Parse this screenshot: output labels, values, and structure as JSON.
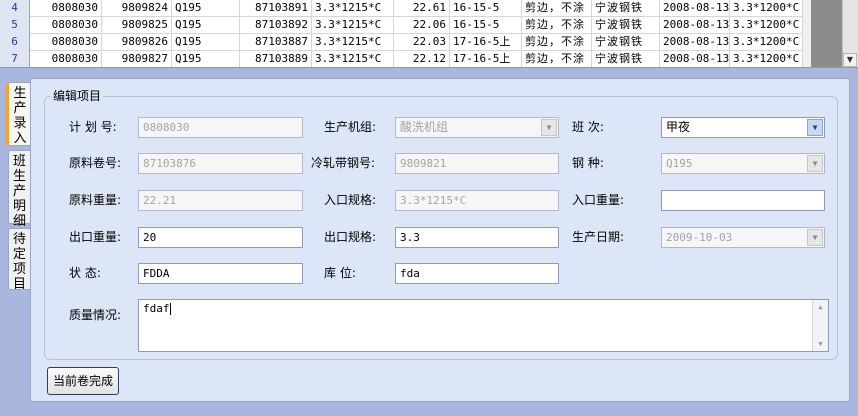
{
  "grid": {
    "rows": [
      {
        "num": "4",
        "c1": "0808030",
        "c2": "9809824",
        "c3": "Q195",
        "c4": "87103891",
        "c5": "3.3*1215*C",
        "c6": "22.61",
        "c7": "16-15-5",
        "c8": "剪边，不涂",
        "c9": "宁波钢铁",
        "c10": "2008-08-13",
        "c11": "3.3*1200*C"
      },
      {
        "num": "5",
        "c1": "0808030",
        "c2": "9809825",
        "c3": "Q195",
        "c4": "87103892",
        "c5": "3.3*1215*C",
        "c6": "22.06",
        "c7": "16-15-5",
        "c8": "剪边，不涂",
        "c9": "宁波钢铁",
        "c10": "2008-08-13",
        "c11": "3.3*1200*C"
      },
      {
        "num": "6",
        "c1": "0808030",
        "c2": "9809826",
        "c3": "Q195",
        "c4": "87103887",
        "c5": "3.3*1215*C",
        "c6": "22.03",
        "c7": "17-16-5上",
        "c8": "剪边，不涂",
        "c9": "宁波钢铁",
        "c10": "2008-08-13",
        "c11": "3.3*1200*C"
      },
      {
        "num": "7",
        "c1": "0808030",
        "c2": "9809827",
        "c3": "Q195",
        "c4": "87103889",
        "c5": "3.3*1215*C",
        "c6": "22.12",
        "c7": "17-16-5上",
        "c8": "剪边，不涂",
        "c9": "宁波钢铁",
        "c10": "2008-08-13",
        "c11": "3.3*1200*C"
      }
    ]
  },
  "tabs": {
    "production_entry": "生产录入",
    "shift_detail": "班生产明细",
    "pending_items": "待定项目"
  },
  "form": {
    "group_title": "编辑项目",
    "plan_no_label": "计 划 号:",
    "plan_no": "0808030",
    "unit_label": "生产机组:",
    "unit": "酸洗机组",
    "shift_label": "班    次:",
    "shift": "甲夜",
    "coil_no_label": "原料卷号:",
    "coil_no": "87103876",
    "cold_steel_no_label": "冷轧带钢号:",
    "cold_steel_no": "9809821",
    "grade_label": "钢    种:",
    "grade": "Q195",
    "raw_weight_label": "原料重量:",
    "raw_weight": "22.21",
    "in_spec_label": "入口规格:",
    "in_spec": "3.3*1215*C",
    "in_weight_label": "入口重量:",
    "in_weight": "",
    "out_weight_label": "出口重量:",
    "out_weight": "20",
    "out_spec_label": "出口规格:",
    "out_spec": "3.3",
    "prod_date_label": "生产日期:",
    "prod_date": "2009-10-03",
    "status_label": "状    态:",
    "status": "FDDA",
    "location_label": "库    位:",
    "location": "fda",
    "quality_label": "质量情况:",
    "quality": "fdaf"
  },
  "actions": {
    "complete_label": "当前卷完成"
  }
}
